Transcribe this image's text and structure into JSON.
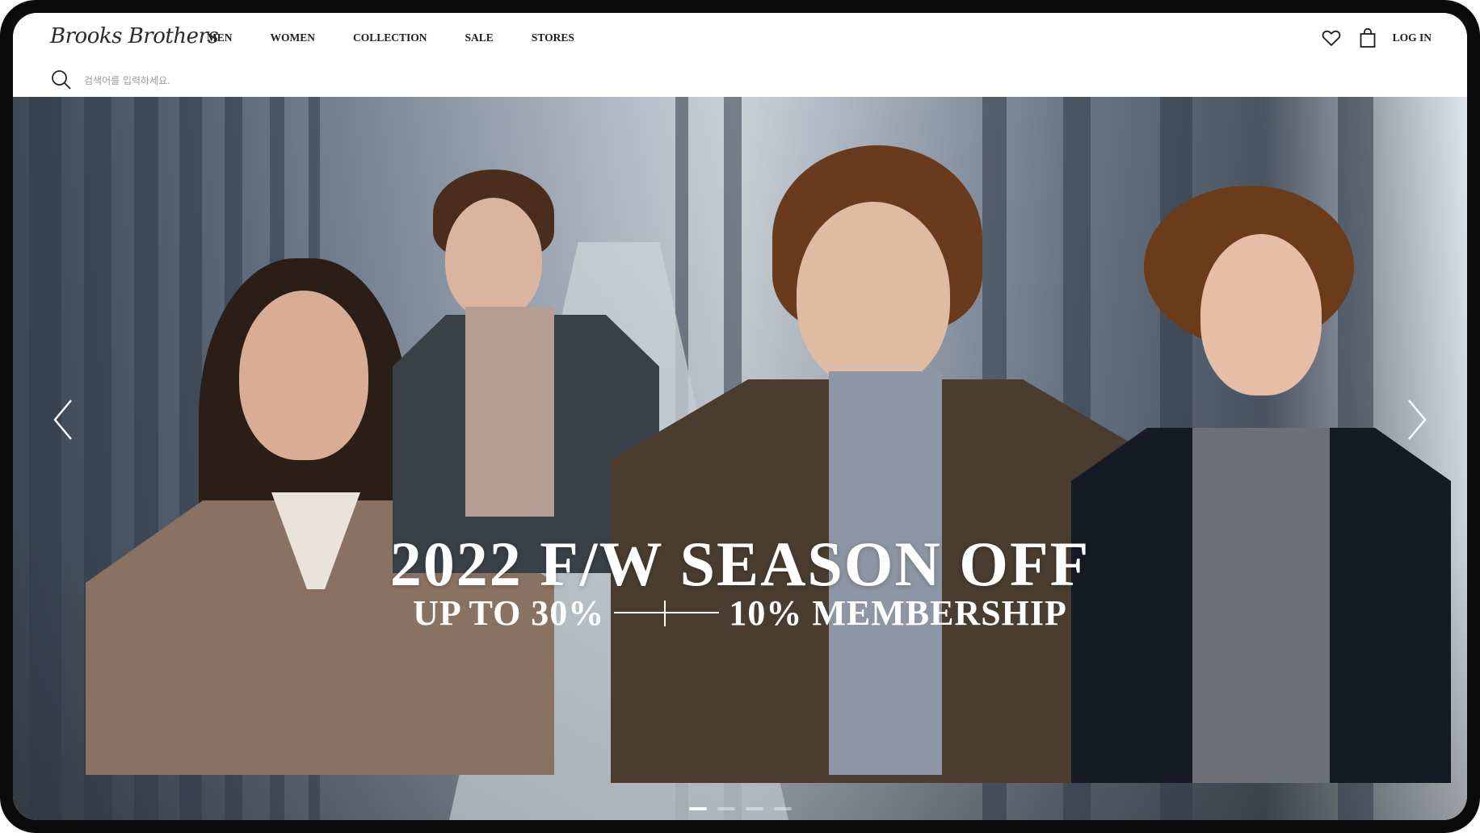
{
  "header": {
    "logo_text": "Brooks Brothers",
    "nav": [
      "MEN",
      "WOMEN",
      "COLLECTION",
      "SALE",
      "STORES"
    ],
    "login_label": "LOG IN",
    "icons": [
      "heart-icon",
      "shopping-bag-icon"
    ]
  },
  "search": {
    "placeholder": "검색어를 입력하세요.",
    "icon": "search-icon"
  },
  "hero": {
    "headline": "2022 F/W SEASON OFF",
    "sub_left": "UP TO 30%",
    "sub_right": "10% MEMBERSHIP",
    "arrows": [
      "chevron-left-icon",
      "chevron-right-icon"
    ],
    "slides_total": 4,
    "active_slide": 1
  },
  "colors": {
    "frame": "#0b0b0b",
    "text_dark": "#1d1d1d",
    "header_border": "#9aa1a6",
    "hero_text": "#ffffff"
  }
}
